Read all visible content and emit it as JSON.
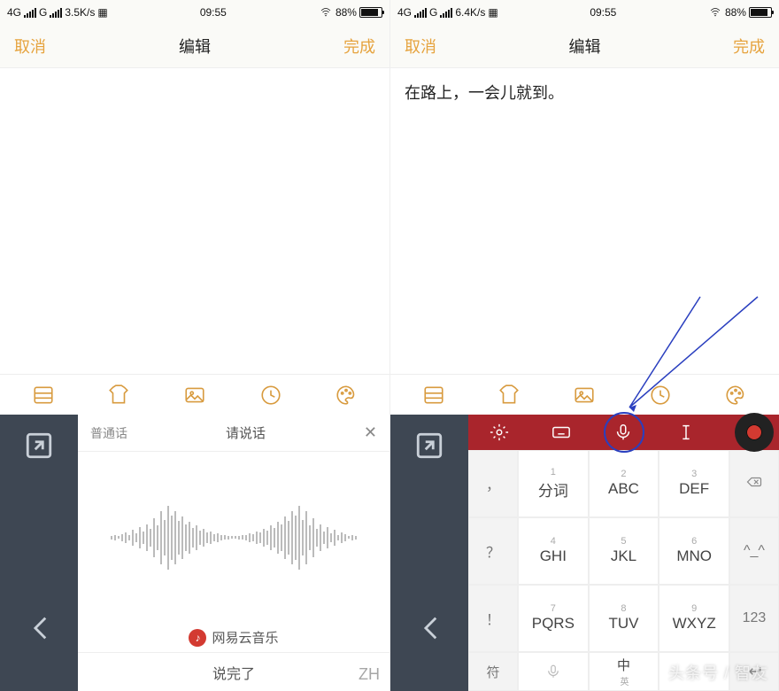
{
  "left": {
    "status": {
      "net": "4G",
      "g": "G",
      "speed": "3.5K/s",
      "time": "09:55",
      "batt": "88%"
    },
    "nav": {
      "cancel": "取消",
      "title": "编辑",
      "done": "完成"
    },
    "editor": {
      "text": ""
    },
    "voice": {
      "lang": "普通话",
      "prompt": "请说话",
      "close": "✕",
      "brand": "网易云音乐",
      "done": "说完了"
    }
  },
  "right": {
    "status": {
      "net": "4G",
      "g": "G",
      "speed": "6.4K/s",
      "time": "09:55",
      "batt": "88%"
    },
    "nav": {
      "cancel": "取消",
      "title": "编辑",
      "done": "完成"
    },
    "editor": {
      "text": "在路上，一会儿就到。"
    },
    "kbtop": [
      "settings",
      "keyboard",
      "mic",
      "cursor",
      "menu"
    ],
    "keys": {
      "r1": [
        {
          "n": "1",
          "l": "分词"
        },
        {
          "n": "2",
          "l": "ABC"
        },
        {
          "n": "3",
          "l": "DEF"
        }
      ],
      "r2": [
        {
          "n": "4",
          "l": "GHI"
        },
        {
          "n": "5",
          "l": "JKL"
        },
        {
          "n": "6",
          "l": "MNO"
        }
      ],
      "r3": [
        {
          "n": "7",
          "l": "PQRS"
        },
        {
          "n": "8",
          "l": "TUV"
        },
        {
          "n": "9",
          "l": "WXYZ"
        }
      ],
      "sideL": [
        "，",
        "？",
        "！"
      ],
      "sideR": [
        "⌫",
        "^_^",
        "123"
      ],
      "bottom": {
        "l": "符",
        "sp": "",
        "lang": "中",
        "langSub": "英",
        "r": ""
      }
    }
  },
  "watermark": {
    "left": "ZH",
    "right": "头条号 / 智友"
  }
}
